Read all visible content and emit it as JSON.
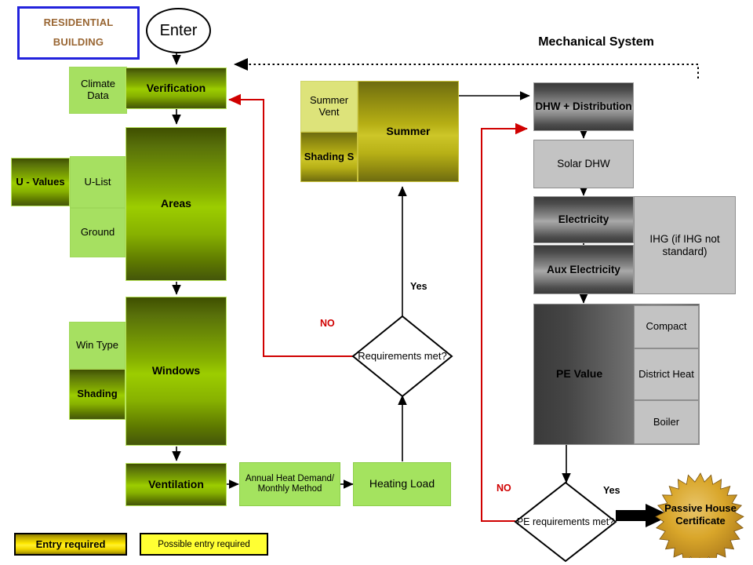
{
  "titles": {
    "residential_line1": "RESIDENTIAL",
    "residential_line2": "BUILDING",
    "mechanical": "Mechanical System"
  },
  "start": {
    "label": "Enter"
  },
  "building_column": {
    "verification": "Verification",
    "climate_data": "Climate Data",
    "areas": "Areas",
    "u_values": "U - Values",
    "u_list": "U-List",
    "ground": "Ground",
    "windows": "Windows",
    "win_type": "Win Type",
    "shading": "Shading",
    "ventilation": "Ventilation"
  },
  "middle_column": {
    "summer": "Summer",
    "summer_vent": "Summer Vent",
    "shading_s": "Shading S",
    "annual_heat": "Annual Heat Demand/ Monthly Method",
    "heating_load": "Heating Load",
    "requirements_met": "Requirements met?"
  },
  "mechanical_column": {
    "dhw_distribution": "DHW + Distribution",
    "solar_dhw": "Solar DHW",
    "electricity": "Electricity",
    "aux_electricity": "Aux Electricity",
    "ihg": "IHG (if IHG not standard)",
    "pe_value": "PE Value",
    "compact": "Compact",
    "district_heat": "District Heat",
    "boiler": "Boiler",
    "pe_requirements_met": "PE requirements met?",
    "passive_house_certificate": "Passive House Certificate"
  },
  "edge_labels": {
    "yes_upper": "Yes",
    "no_upper": "NO",
    "yes_lower": "Yes",
    "no_lower": "NO"
  },
  "legend": {
    "entry_required": "Entry required",
    "possible_entry_required": "Possible entry required"
  },
  "colors": {
    "title_border": "#2222dd",
    "title_text": "#996633",
    "entry_required_yellow": "#ffe900",
    "possible_entry_yellow": "#ffff33",
    "no_path_red": "#d00000",
    "green_dark": "#9ccd00",
    "green_light": "#a6e061",
    "olive_dark": "#cdc628",
    "olive_light": "#dde37a",
    "grey_dark": "#4b4b4b",
    "grey_light": "#c3c3c3",
    "certificate_gold": "#d4a017"
  }
}
